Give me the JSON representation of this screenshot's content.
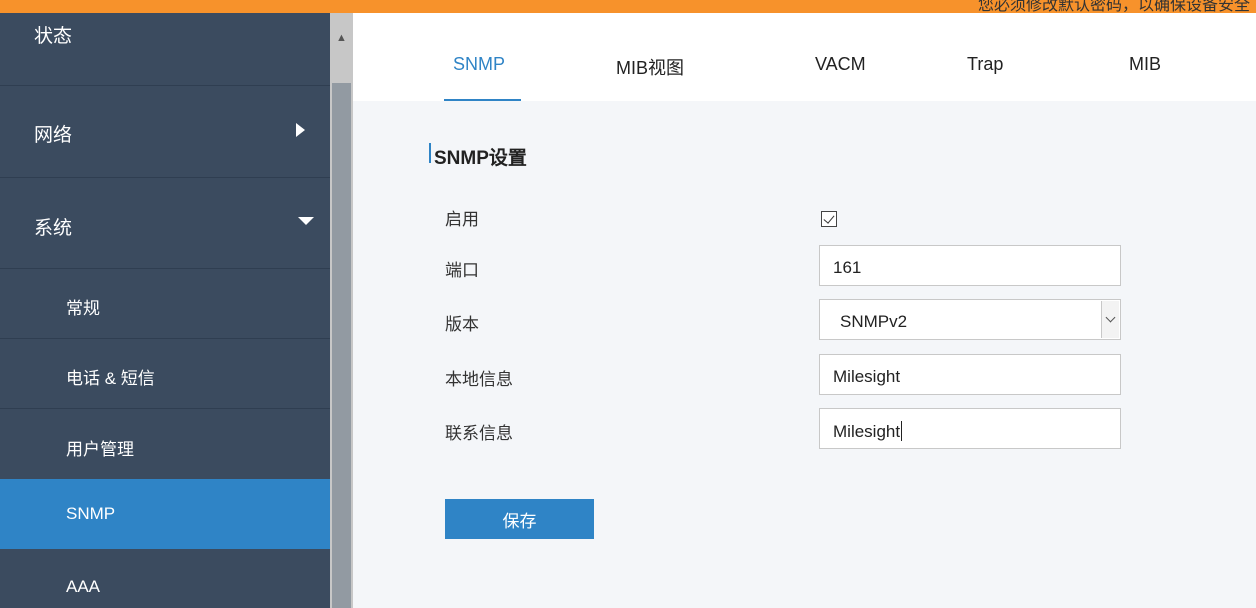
{
  "topbar": {
    "text": "您必须修改默认密码，以确保设备安全"
  },
  "sidebar": {
    "items": [
      {
        "label": "状态"
      },
      {
        "label": "网络"
      },
      {
        "label": "系统"
      },
      {
        "label": "常规"
      },
      {
        "label": "电话 & 短信"
      },
      {
        "label": "用户管理"
      },
      {
        "label": "SNMP"
      },
      {
        "label": "AAA"
      }
    ],
    "active": "SNMP"
  },
  "tabs": [
    {
      "label": "SNMP"
    },
    {
      "label": "MIB视图"
    },
    {
      "label": "VACM"
    },
    {
      "label": "Trap"
    },
    {
      "label": "MIB"
    }
  ],
  "section": {
    "title": "SNMP设置"
  },
  "form": {
    "enable_label": "启用",
    "enable_checked": true,
    "port_label": "端口",
    "port_value": "161",
    "version_label": "版本",
    "version_value": "SNMPv2",
    "location_label": "本地信息",
    "location_value": "Milesight",
    "contact_label": "联系信息",
    "contact_value": "Milesight"
  },
  "buttons": {
    "save": "保存"
  },
  "colors": {
    "accent": "#2f84c6",
    "sidebar": "#3b4b5f",
    "topbar": "#f7922b",
    "content_bg": "#f4f6f9"
  }
}
